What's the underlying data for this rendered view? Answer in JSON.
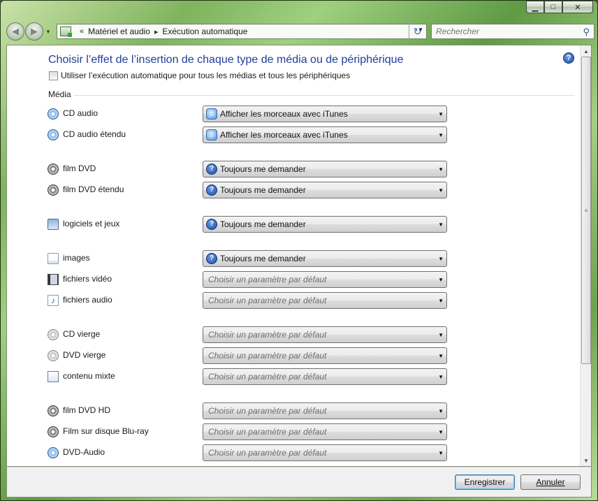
{
  "window": {
    "minimize_glyph": "▁",
    "maximize_glyph": "□",
    "close_glyph": "✕"
  },
  "nav": {
    "back_glyph": "◀",
    "forward_glyph": "▶",
    "dropdown_glyph": "▼",
    "breadcrumb": [
      "«",
      "Matériel et audio",
      "▸",
      "Exécution automatique"
    ],
    "refresh_glyph": "↻",
    "search_placeholder": "Rechercher",
    "search_glyph": "⚲"
  },
  "header": {
    "title": "Choisir l’effet de l’insertion de chaque type de média ou de périphérique",
    "help_glyph": "?",
    "use_all_checkbox_label": "Utiliser l’exécution automatique pour tous les médias et tous les périphériques",
    "use_all_checked": false
  },
  "section": {
    "label": "Média"
  },
  "media_rows": [
    {
      "icon": "cd-audio-icon",
      "label": "CD audio",
      "value": "Afficher les morceaux avec iTunes",
      "value_icon": "itunes-icon",
      "placeholder": false
    },
    {
      "icon": "cd-audio-icon",
      "label": "CD audio étendu",
      "value": "Afficher les morceaux avec iTunes",
      "value_icon": "itunes-icon",
      "placeholder": false
    },
    {
      "icon": "dvd-icon",
      "label": "film DVD",
      "value": "Toujours me demander",
      "value_icon": "ask-icon",
      "placeholder": false
    },
    {
      "icon": "dvd-icon",
      "label": "film DVD étendu",
      "value": "Toujours me demander",
      "value_icon": "ask-icon",
      "placeholder": false
    },
    {
      "icon": "games-icon",
      "label": "logiciels et jeux",
      "value": "Toujours me demander",
      "value_icon": "ask-icon",
      "placeholder": false
    },
    {
      "icon": "image-file-icon",
      "label": "images",
      "value": "Toujours me demander",
      "value_icon": "ask-icon",
      "placeholder": false
    },
    {
      "icon": "video-file-icon",
      "label": "fichiers vidéo",
      "value": "Choisir un paramètre par défaut",
      "value_icon": "",
      "placeholder": true
    },
    {
      "icon": "audio-file-icon",
      "label": "fichiers audio",
      "value": "Choisir un paramètre par défaut",
      "value_icon": "",
      "placeholder": true
    },
    {
      "icon": "blank-cd-icon",
      "label": "CD vierge",
      "value": "Choisir un paramètre par défaut",
      "value_icon": "",
      "placeholder": true
    },
    {
      "icon": "blank-dvd-icon",
      "label": "DVD vierge",
      "value": "Choisir un paramètre par défaut",
      "value_icon": "",
      "placeholder": true
    },
    {
      "icon": "mixed-content-icon",
      "label": "contenu mixte",
      "value": "Choisir un paramètre par défaut",
      "value_icon": "",
      "placeholder": true
    },
    {
      "icon": "dvd-icon",
      "label": "film DVD HD",
      "value": "Choisir un paramètre par défaut",
      "value_icon": "",
      "placeholder": true
    },
    {
      "icon": "dvd-icon",
      "label": "Film sur disque Blu-ray",
      "value": "Choisir un paramètre par défaut",
      "value_icon": "",
      "placeholder": true
    },
    {
      "icon": "cd-audio-icon",
      "label": "DVD-Audio",
      "value": "Choisir un paramètre par défaut",
      "value_icon": "",
      "placeholder": true
    }
  ],
  "footer": {
    "save_label": "Enregistrer",
    "cancel_label": "Annuler"
  },
  "scrollbar": {
    "up_glyph": "▲",
    "down_glyph": "▼",
    "grip_glyph": "≡"
  }
}
